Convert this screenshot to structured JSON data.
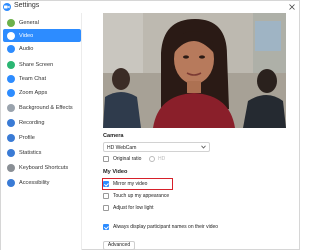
{
  "window": {
    "title": "Settings"
  },
  "sidebar": {
    "items": [
      {
        "label": "General",
        "icon": "gear-icon",
        "color": "#6cb14b",
        "active": false
      },
      {
        "label": "Video",
        "icon": "video-icon",
        "color": "#2d8cff",
        "active": true
      },
      {
        "label": "Audio",
        "icon": "headphones-icon",
        "color": "#2d8cff",
        "active": false
      },
      {
        "label": "Share Screen",
        "icon": "share-screen-icon",
        "color": "#2bb673",
        "active": false
      },
      {
        "label": "Team Chat",
        "icon": "chat-icon",
        "color": "#2d8cff",
        "active": false
      },
      {
        "label": "Zoom Apps",
        "icon": "apps-icon",
        "color": "#2d8cff",
        "active": false
      },
      {
        "label": "Background & Effects",
        "icon": "background-icon",
        "color": "#9aa3ad",
        "active": false
      },
      {
        "label": "Recording",
        "icon": "recording-icon",
        "color": "#3a7bd5",
        "active": false
      },
      {
        "label": "Profile",
        "icon": "profile-icon",
        "color": "#3a7bd5",
        "active": false
      },
      {
        "label": "Statistics",
        "icon": "statistics-icon",
        "color": "#3a7bd5",
        "active": false
      },
      {
        "label": "Keyboard Shortcuts",
        "icon": "keyboard-icon",
        "color": "#8a8f95",
        "active": false
      },
      {
        "label": "Accessibility",
        "icon": "accessibility-icon",
        "color": "#3a7bd5",
        "active": false
      }
    ]
  },
  "video": {
    "camera_heading": "Camera",
    "camera_selected": "HD WebCam",
    "original_ratio_label": "Original ratio",
    "original_ratio_checked": false,
    "hd_label": "HD",
    "my_video_heading": "My Video",
    "mirror_label": "Mirror my video",
    "mirror_checked": true,
    "touch_up_label": "Touch up my appearance",
    "touch_up_checked": false,
    "low_light_label": "Adjust for low light",
    "low_light_checked": false,
    "always_display_names_label": "Always display participant names on their video",
    "always_display_names_checked": true,
    "advanced_button": "Advanced"
  },
  "colors": {
    "accent": "#2d8cff",
    "highlight_border": "#d6202a"
  }
}
